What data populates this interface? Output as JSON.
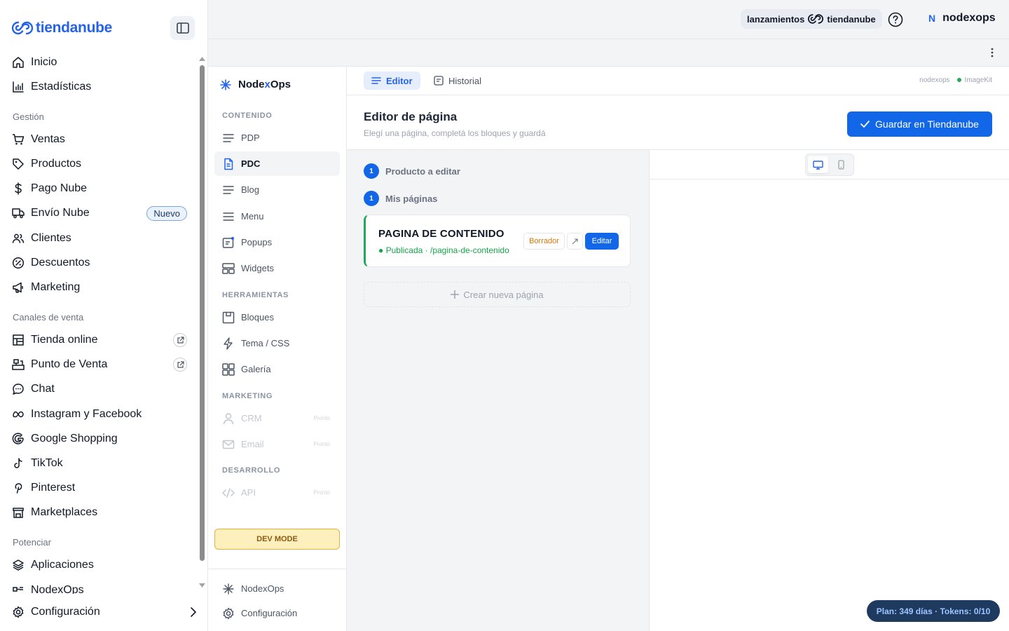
{
  "brand": {
    "logo_text": "tiendanube",
    "color": "#2563eb"
  },
  "sidebar": {
    "items": [
      {
        "label": "Inicio",
        "icon": "home-icon"
      },
      {
        "label": "Estadísticas",
        "icon": "chart-icon"
      }
    ],
    "sections": [
      {
        "title": "Gestión",
        "items": [
          {
            "label": "Ventas",
            "icon": "cart-icon"
          },
          {
            "label": "Productos",
            "icon": "tag-icon"
          },
          {
            "label": "Pago Nube",
            "icon": "dollar-icon"
          },
          {
            "label": "Envío Nube",
            "icon": "truck-icon",
            "badge": "Nuevo"
          },
          {
            "label": "Clientes",
            "icon": "users-icon"
          },
          {
            "label": "Descuentos",
            "icon": "discount-icon"
          },
          {
            "label": "Marketing",
            "icon": "megaphone-icon"
          }
        ]
      },
      {
        "title": "Canales de venta",
        "items": [
          {
            "label": "Tienda online",
            "icon": "store-icon",
            "external": true
          },
          {
            "label": "Punto de Venta",
            "icon": "pos-icon",
            "external": true
          },
          {
            "label": "Chat",
            "icon": "chat-icon"
          },
          {
            "label": "Instagram y Facebook",
            "icon": "meta-icon"
          },
          {
            "label": "Google Shopping",
            "icon": "google-icon"
          },
          {
            "label": "TikTok",
            "icon": "tiktok-icon"
          },
          {
            "label": "Pinterest",
            "icon": "pinterest-icon"
          },
          {
            "label": "Marketplaces",
            "icon": "marketplace-icon"
          }
        ]
      },
      {
        "title": "Potenciar",
        "items": [
          {
            "label": "Aplicaciones",
            "icon": "apps-icon"
          },
          {
            "label": "NodexOps",
            "icon": "nodexops-icon"
          }
        ]
      }
    ],
    "footer": {
      "label": "Configuración",
      "icon": "gear-icon"
    }
  },
  "topbar": {
    "launch_prefix": "lanzamientos",
    "launch_brand": "tiendanube",
    "user_initial": "N",
    "user_name": "nodexops"
  },
  "app": {
    "name_part1": "Node",
    "name_x": "x",
    "name_part2": "Ops",
    "sections": [
      {
        "title": "CONTENIDO",
        "items": [
          {
            "label": "PDP",
            "icon": "lines-icon"
          },
          {
            "label": "PDC",
            "icon": "document-icon",
            "active": true
          },
          {
            "label": "Blog",
            "icon": "lines-icon"
          },
          {
            "label": "Menu",
            "icon": "menu-icon"
          },
          {
            "label": "Popups",
            "icon": "popup-icon"
          },
          {
            "label": "Widgets",
            "icon": "widgets-icon"
          }
        ]
      },
      {
        "title": "HERRAMIENTAS",
        "items": [
          {
            "label": "Bloques",
            "icon": "blocks-icon"
          },
          {
            "label": "Tema / CSS",
            "icon": "bolt-icon"
          },
          {
            "label": "Galería",
            "icon": "grid-icon"
          }
        ]
      },
      {
        "title": "MARKETING",
        "items": [
          {
            "label": "CRM",
            "icon": "person-icon",
            "soon": "Pronto"
          },
          {
            "label": "Email",
            "icon": "mail-icon",
            "soon": "Pronto"
          }
        ]
      },
      {
        "title": "DESARROLLO",
        "items": [
          {
            "label": "API",
            "icon": "code-icon",
            "soon": "Pronto"
          }
        ]
      }
    ],
    "dev_mode": "DEV MODE",
    "footer": [
      {
        "label": "NodexOps",
        "icon": "asterisk-icon"
      },
      {
        "label": "Configuración",
        "icon": "gear-icon"
      }
    ]
  },
  "tabs": [
    {
      "label": "Editor",
      "icon": "editor-icon",
      "active": true
    },
    {
      "label": "Historial",
      "icon": "history-icon"
    }
  ],
  "status": {
    "store": "nodexops",
    "service": "ImageKit",
    "service_color": "#22a85a"
  },
  "editor": {
    "title": "Editor de página",
    "subtitle": "Elegí una página, completá los bloques y guardá",
    "save_button": "Guardar en Tiendanube",
    "step1": {
      "num": "1",
      "label": "Producto a editar"
    },
    "step2": {
      "num": "1",
      "label": "Mis páginas"
    },
    "page_card": {
      "title": "PAGINA DE CONTENIDO",
      "status": "Publicada",
      "slug": "/pagina-de-contenido",
      "draft_button": "Borrador",
      "edit_button": "Editar"
    },
    "new_page": "Crear nueva página"
  },
  "plan_badge": "Plan: 349 días · Tokens: 0/10"
}
